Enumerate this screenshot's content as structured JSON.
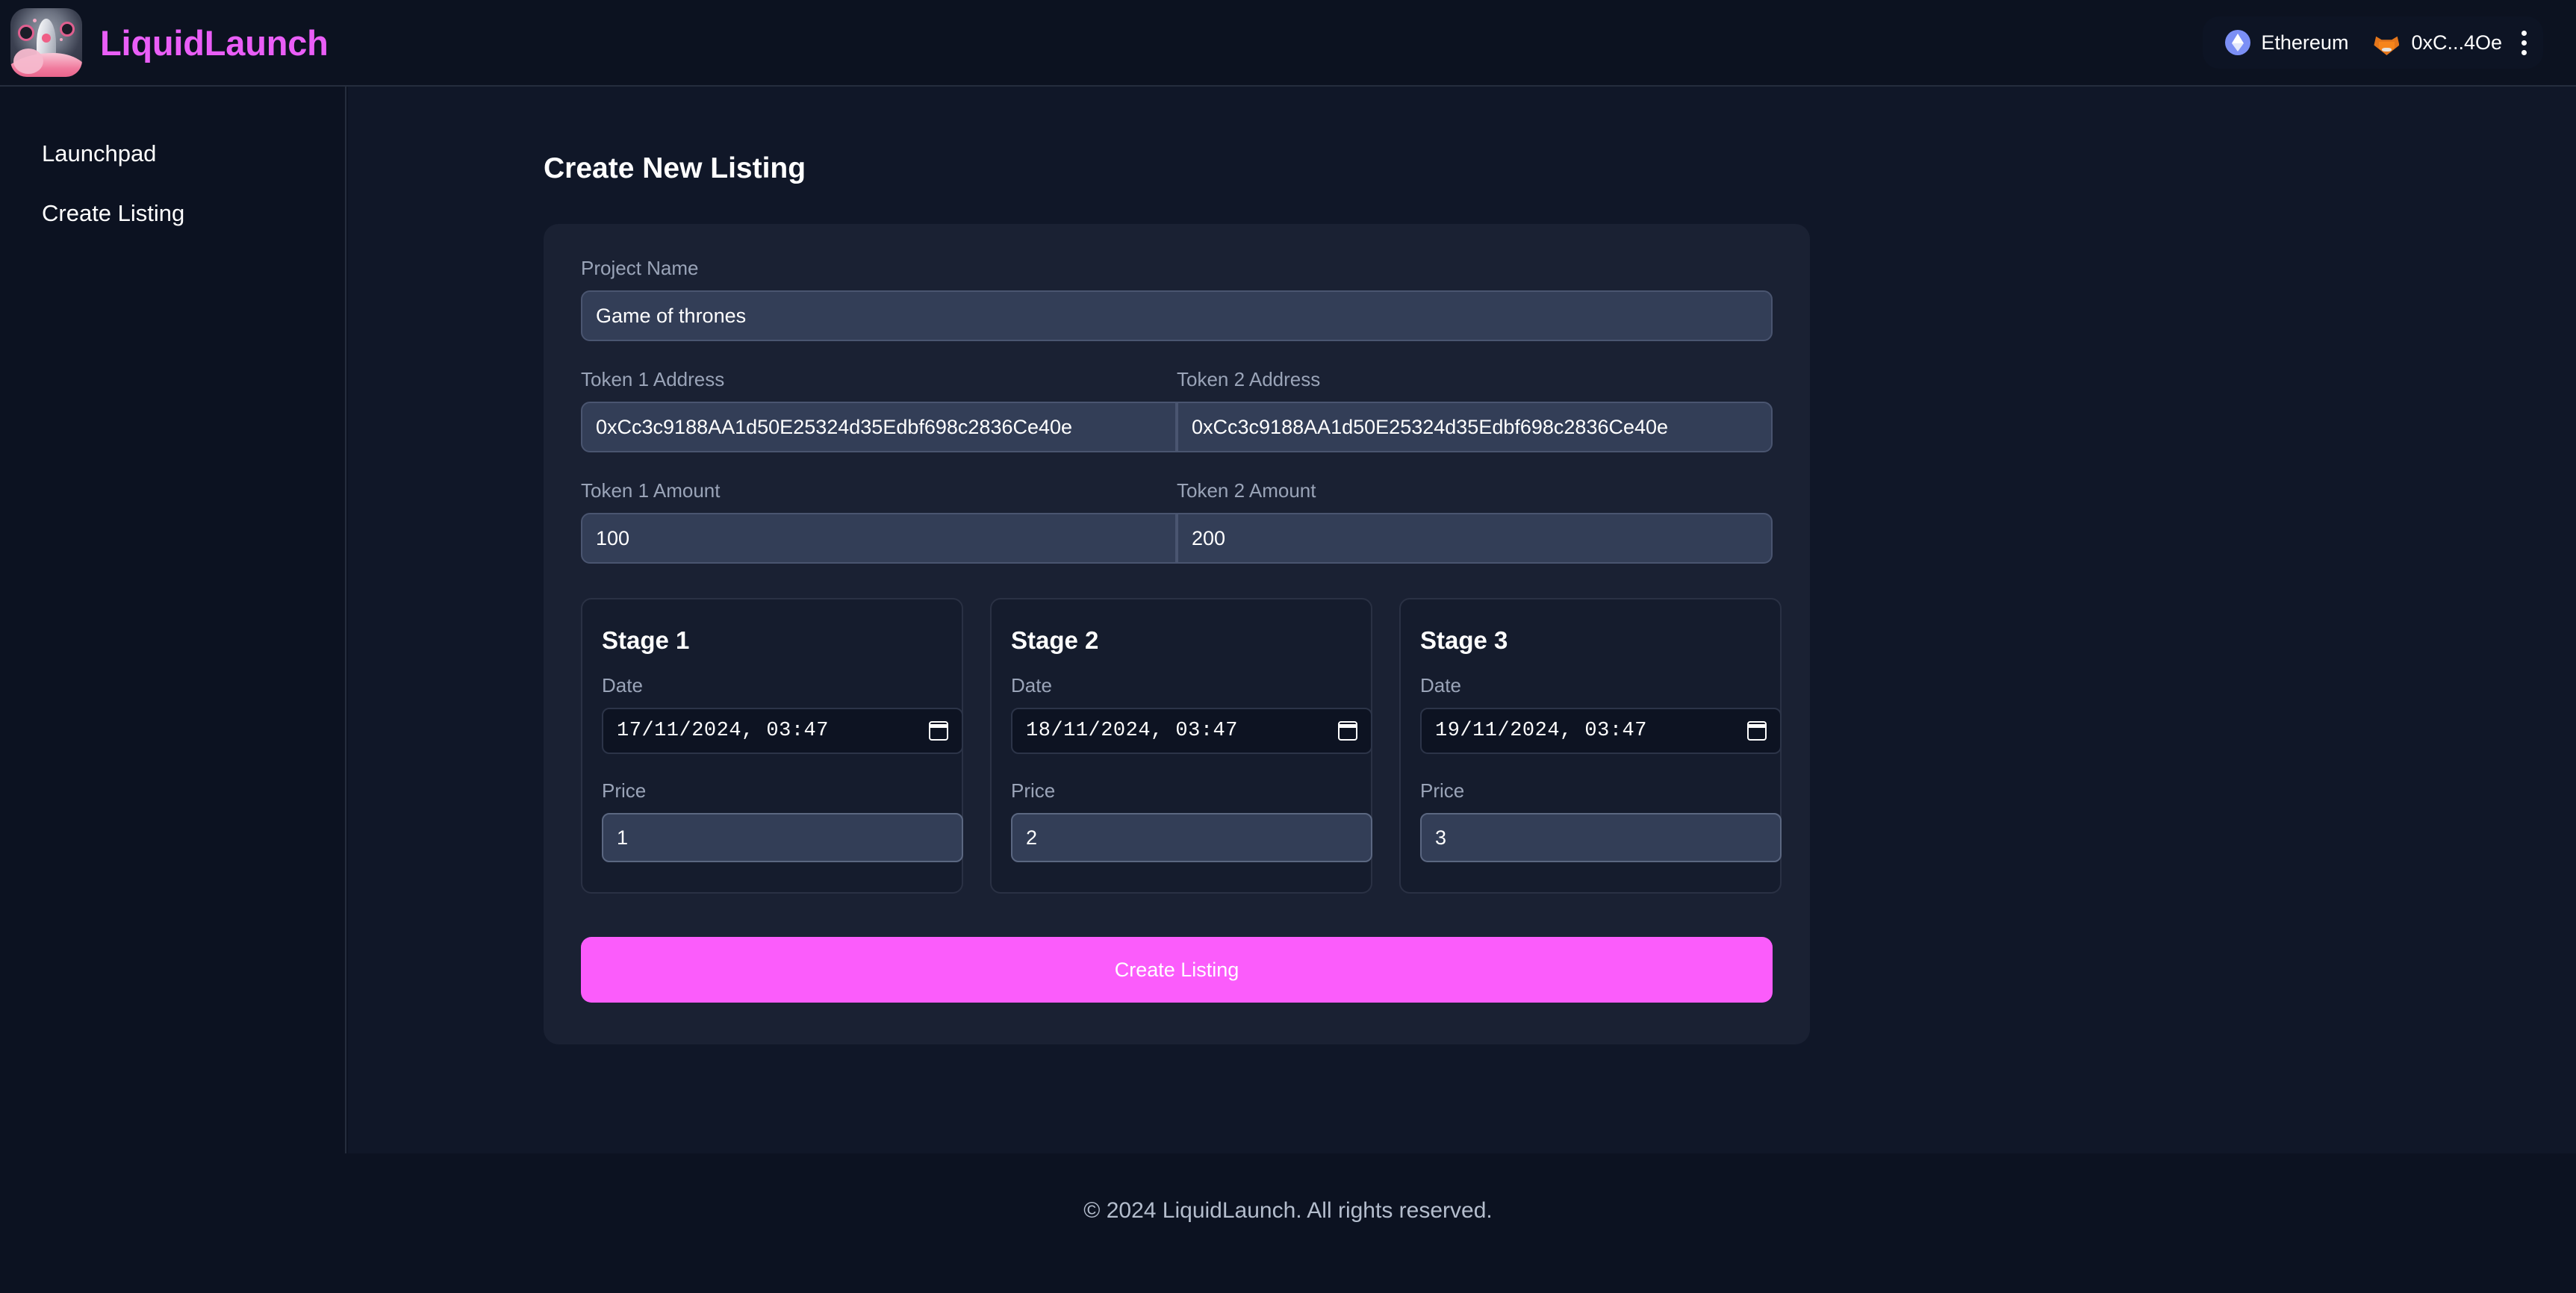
{
  "header": {
    "brand_name": "LiquidLaunch",
    "logo_icon": "rocket-liquid-logo",
    "chain": {
      "label": "Ethereum",
      "icon": "ethereum-icon"
    },
    "account": {
      "label": "0xC...4Oe",
      "icon": "metamask-fox-icon"
    },
    "menu_icon": "kebab-menu-icon",
    "accent_color": "#ea5ef7"
  },
  "sidebar": {
    "items": [
      {
        "label": "Launchpad"
      },
      {
        "label": "Create Listing"
      }
    ]
  },
  "main": {
    "page_title": "Create New Listing",
    "fields": {
      "project_name": {
        "label": "Project Name",
        "value": "Game of thrones",
        "placeholder": "Project Name"
      },
      "token1_address": {
        "label": "Token 1 Address",
        "value": "0xCc3c9188AA1d50E25324d35Edbf698c2836Ce40e",
        "placeholder": "Token 1 Address"
      },
      "token2_address": {
        "label": "Token 2 Address",
        "value": "0xCc3c9188AA1d50E25324d35Edbf698c2836Ce40e",
        "placeholder": "Token 2 Address"
      },
      "token1_amount": {
        "label": "Token 1 Amount",
        "value": "100",
        "placeholder": "Token 1 Amount"
      },
      "token2_amount": {
        "label": "Token 2 Amount",
        "value": "200",
        "placeholder": "Token 2 Amount"
      }
    },
    "stages": [
      {
        "title": "Stage 1",
        "date_label": "Date",
        "date_value": "17/11/2024, 03:47",
        "price_label": "Price",
        "price_value": "1",
        "calendar_icon": "calendar-icon"
      },
      {
        "title": "Stage 2",
        "date_label": "Date",
        "date_value": "18/11/2024, 03:47",
        "price_label": "Price",
        "price_value": "2",
        "calendar_icon": "calendar-icon"
      },
      {
        "title": "Stage 3",
        "date_label": "Date",
        "date_value": "19/11/2024, 03:47",
        "price_label": "Price",
        "price_value": "3",
        "calendar_icon": "calendar-icon"
      }
    ],
    "submit_label": "Create Listing",
    "submit_color": "#fb5cfb"
  },
  "footer": {
    "text": "© 2024 LiquidLaunch. All rights reserved."
  }
}
